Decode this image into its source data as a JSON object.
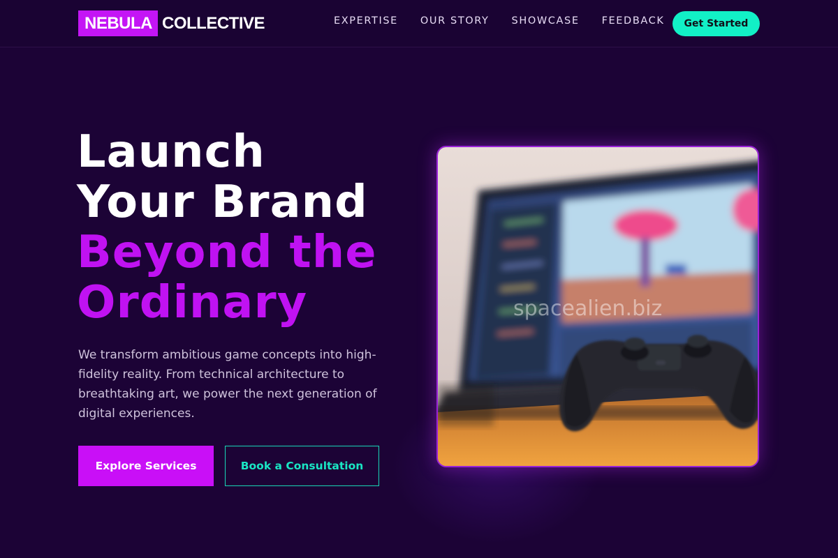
{
  "brand": {
    "primary": "NEBULA",
    "secondary": "COLLECTIVE"
  },
  "nav": {
    "links": [
      "EXPERTISE",
      "OUR STORY",
      "SHOWCASE",
      "FEEDBACK"
    ],
    "cta_label": "Get Started"
  },
  "hero": {
    "title_lines": [
      "Launch",
      "Your Brand",
      "Beyond the",
      "Ordinary"
    ],
    "description": "We transform ambitious game concepts into high-fidelity reality. From technical architecture to breathtaking art, we power the next generation of digital experiences.",
    "primary_button": "Explore Services",
    "secondary_button": "Book a Consultation",
    "image_watermark": "spacealien.biz"
  },
  "colors": {
    "background": "#1c0336",
    "accent_magenta": "#c90ff7",
    "accent_teal": "#12f0c6",
    "text_light": "#cfc3dc"
  },
  "icons": {
    "hero_image": "laptop-with-game-controller-photo"
  }
}
